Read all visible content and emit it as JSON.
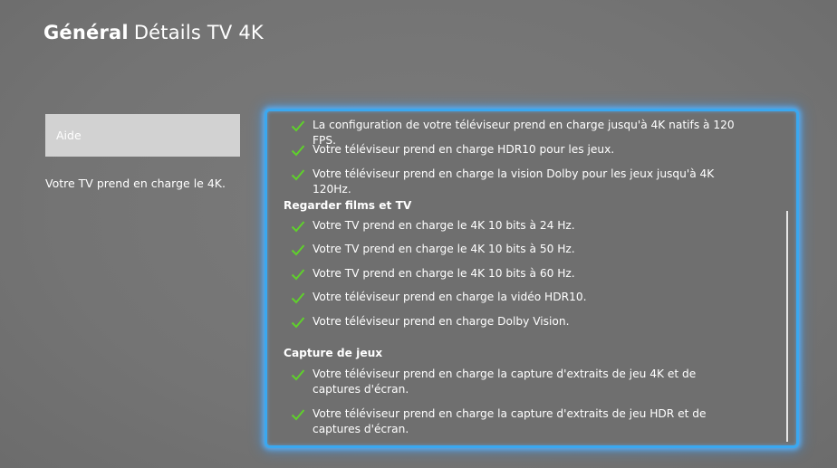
{
  "header": {
    "section": "Général",
    "title": "Détails TV 4K"
  },
  "sidebar": {
    "aide_label": "Aide",
    "description": "Votre TV prend en charge le 4K."
  },
  "panel": {
    "intro_items": [
      "La configuration de votre téléviseur prend en charge jusqu'à 4K natifs à 120 FPS.",
      "Votre téléviseur prend en charge HDR10 pour les jeux.",
      "Votre téléviseur prend en charge la vision Dolby pour les jeux jusqu'à 4K 120Hz."
    ],
    "films": {
      "title": "Regarder films et TV",
      "items": [
        "Votre TV prend en charge le 4K 10 bits à 24 Hz.",
        "Votre TV prend en charge le 4K 10 bits à 50 Hz.",
        "Votre TV prend en charge le 4K 10 bits à 60 Hz.",
        "Votre téléviseur prend en charge la vidéo HDR10.",
        "Votre téléviseur prend en charge Dolby Vision."
      ]
    },
    "capture": {
      "title": "Capture de jeux",
      "items": [
        "Votre téléviseur prend en charge la capture d'extraits de jeu 4K et de captures d'écran.",
        "Votre téléviseur prend en charge la capture d'extraits de jeu HDR et de captures d'écran."
      ]
    }
  },
  "colors": {
    "focus": "#3aa8f0",
    "check": "#5fd12b"
  },
  "icons": {
    "check": "checkmark-icon"
  }
}
